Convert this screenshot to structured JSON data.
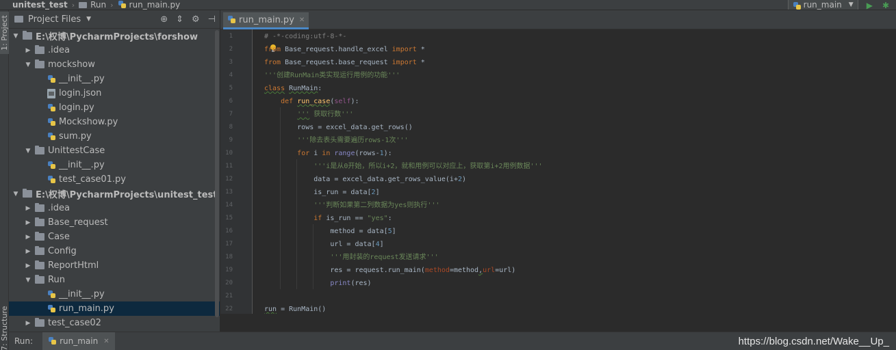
{
  "navbar": {
    "project": "unitest_test",
    "folder": "Run",
    "file": "run_main.py",
    "run_config": "run_main"
  },
  "stripe": {
    "project_tab": "1: Project",
    "structure_tab": "7: Structure"
  },
  "project_panel": {
    "title": "Project Files",
    "tree": [
      {
        "label": "E:\\权博\\PycharmProjects\\forshow",
        "type": "folder",
        "level": 0,
        "expanded": true,
        "bold": true
      },
      {
        "label": ".idea",
        "type": "folder",
        "level": 1,
        "expanded": false
      },
      {
        "label": "mockshow",
        "type": "folder",
        "level": 1,
        "expanded": true
      },
      {
        "label": "__init__.py",
        "type": "py",
        "level": 2
      },
      {
        "label": "login.json",
        "type": "json",
        "level": 2
      },
      {
        "label": "login.py",
        "type": "py",
        "level": 2
      },
      {
        "label": "Mockshow.py",
        "type": "py",
        "level": 2
      },
      {
        "label": "sum.py",
        "type": "py",
        "level": 2
      },
      {
        "label": "UnittestCase",
        "type": "folder",
        "level": 1,
        "expanded": true
      },
      {
        "label": "__init__.py",
        "type": "py",
        "level": 2
      },
      {
        "label": "test_case01.py",
        "type": "py",
        "level": 2
      },
      {
        "label": "E:\\权博\\PycharmProjects\\unitest_test",
        "type": "folder",
        "level": 0,
        "expanded": true,
        "bold": true
      },
      {
        "label": ".idea",
        "type": "folder",
        "level": 1,
        "expanded": false
      },
      {
        "label": "Base_request",
        "type": "folder",
        "level": 1,
        "expanded": false
      },
      {
        "label": "Case",
        "type": "folder",
        "level": 1,
        "expanded": false
      },
      {
        "label": "Config",
        "type": "folder",
        "level": 1,
        "expanded": false
      },
      {
        "label": "ReportHtml",
        "type": "folder",
        "level": 1,
        "expanded": false
      },
      {
        "label": "Run",
        "type": "folder",
        "level": 1,
        "expanded": true
      },
      {
        "label": "__init__.py",
        "type": "py",
        "level": 2
      },
      {
        "label": "run_main.py",
        "type": "py",
        "level": 2,
        "selected": true
      },
      {
        "label": "test_case02",
        "type": "folder",
        "level": 1,
        "expanded": false
      }
    ]
  },
  "editor": {
    "tab_label": "run_main.py",
    "line_numbers": [
      "1",
      "2",
      "3",
      "4",
      "5",
      "6",
      "7",
      "8",
      "9",
      "10",
      "11",
      "12",
      "13",
      "14",
      "15",
      "16",
      "17",
      "18",
      "19",
      "20",
      "21",
      "22"
    ]
  },
  "bottom": {
    "run_label": "Run:",
    "run_tab": "run_main"
  },
  "watermark": "https://blog.csdn.net/Wake__Up_"
}
